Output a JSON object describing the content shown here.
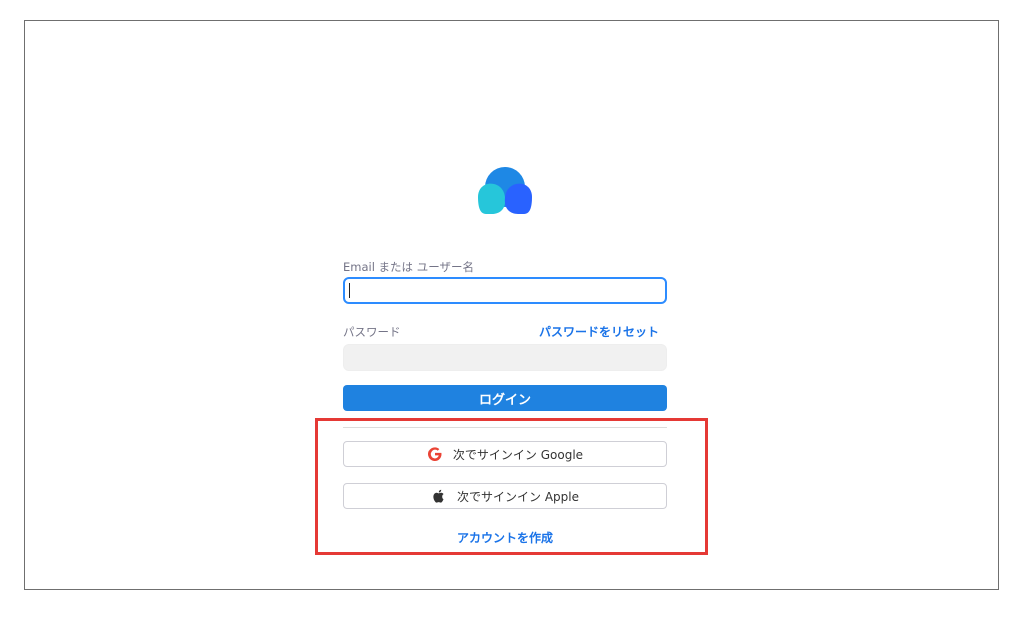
{
  "login_form": {
    "email_label": "Email または ユーザー名",
    "email_value": "",
    "password_label": "パスワード",
    "password_value": "",
    "reset_password_link": "パスワードをリセット",
    "login_button": "ログイン"
  },
  "sso": {
    "google_button": "次でサインイン Google",
    "google_icon": "google-g-icon",
    "apple_button": "次でサインイン Apple",
    "apple_icon": "apple-icon"
  },
  "create_account_link": "アカウントを作成",
  "colors": {
    "accent": "#1f82e0",
    "link": "#1a73e8",
    "focus_border": "#2d8cff",
    "highlight": "#e53935",
    "google_red": "#ea4335"
  },
  "logo": {
    "icon": "cloud-logo-icon"
  }
}
